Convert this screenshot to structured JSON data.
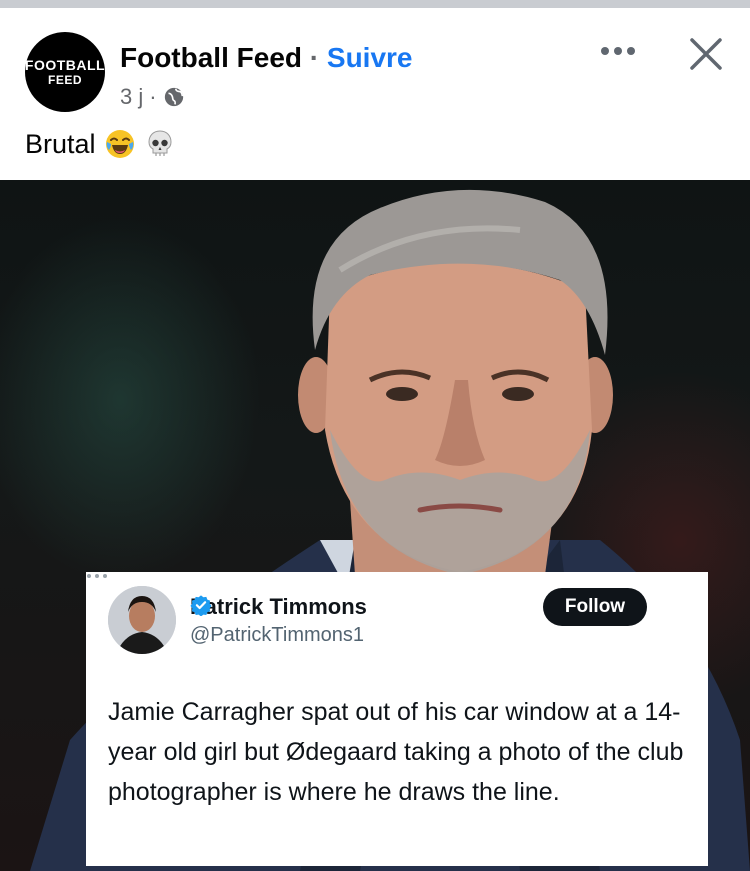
{
  "post": {
    "avatar_line1": "FOOTBALL",
    "avatar_line2": "FEED",
    "page_name": "Football Feed",
    "separator": "·",
    "follow_label": "Suivre",
    "time": "3 j",
    "time_sep": "·",
    "caption": "Brutal",
    "icons": [
      "globe-icon",
      "more-options-icon",
      "close-icon",
      "laughing-emoji-icon",
      "skull-emoji-icon"
    ]
  },
  "tweet": {
    "name": "Patrick Timmons",
    "handle": "@PatrickTimmons1",
    "follow_label": "Follow",
    "text": "Jamie Carragher spat out of his car window at a 14-year old girl but Ødegaard taking a photo of the club photographer is where he draws the line.",
    "icons": [
      "verified-badge-icon",
      "more-options-icon"
    ]
  },
  "colors": {
    "link": "#1877f2",
    "secondary_text": "#65676b",
    "verified": "#1d9bf0",
    "follow_button": "#0f1419"
  }
}
